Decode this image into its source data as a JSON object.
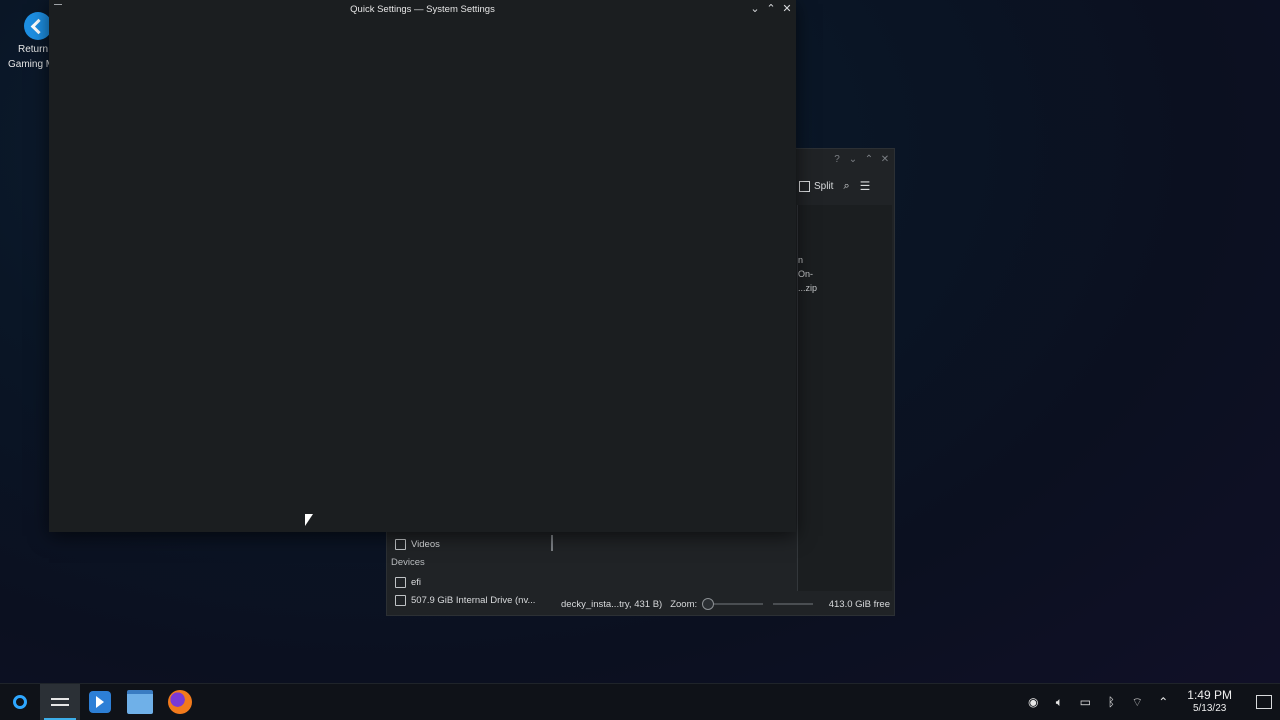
{
  "desktop": {
    "icon_label_line1": "Return",
    "icon_label_line2": "Gaming Mode"
  },
  "quick_settings_window": {
    "title": "Quick Settings — System Settings"
  },
  "file_manager": {
    "toolbar": {
      "split_label": "Split"
    },
    "view_fragments": [
      "n",
      "On-",
      "...zip"
    ],
    "sidebar": {
      "places_item": "Videos",
      "devices_header": "Devices",
      "devices": [
        "efi",
        "507.9 GiB Internal Drive (nv..."
      ]
    },
    "status": {
      "selection": "decky_insta...try, 431 B)",
      "zoom_label": "Zoom:",
      "free_space": "413.0 GiB free"
    }
  },
  "taskbar": {
    "clock_time": "1:49 PM",
    "clock_date": "5/13/23"
  },
  "colors": {
    "accent": "#3daee9",
    "window_bg": "#1b1e20"
  }
}
